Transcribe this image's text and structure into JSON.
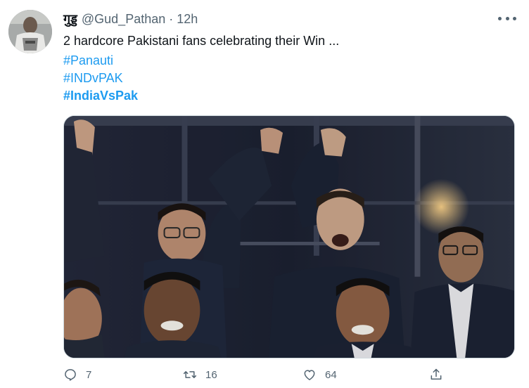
{
  "tweet": {
    "display_name": "गुड्ड",
    "handle": "@Gud_Pathan",
    "separator": "·",
    "time": "12h",
    "text": "2 hardcore Pakistani fans celebrating their Win ...",
    "hashtags": [
      "#Panauti",
      "#INDvPAK",
      "#IndiaVsPak"
    ]
  },
  "actions": {
    "reply_count": "7",
    "retweet_count": "16",
    "like_count": "64"
  },
  "icons": {
    "reply": "reply-icon",
    "retweet": "retweet-icon",
    "like": "heart-icon",
    "share": "share-icon",
    "more": "more-options-icon"
  },
  "colors": {
    "hashtag": "#1d9bf0",
    "secondary_text": "#536471",
    "primary_text": "#0f1419"
  }
}
